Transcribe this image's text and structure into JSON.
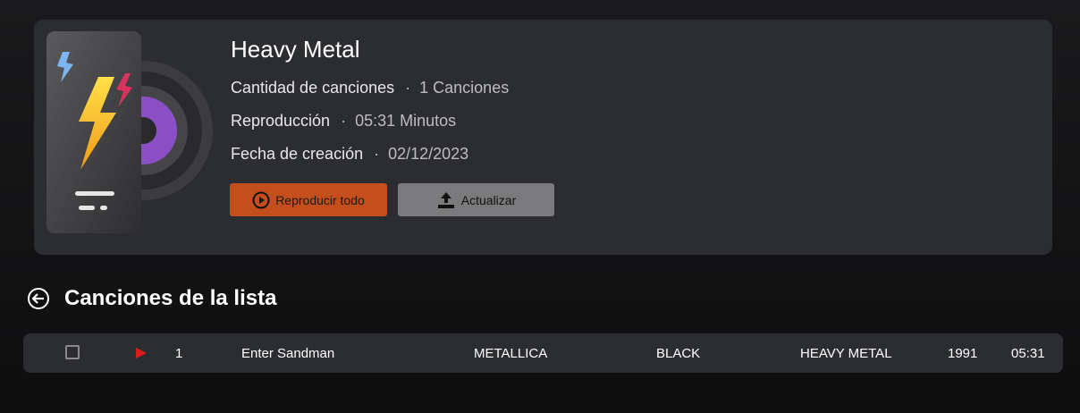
{
  "playlist": {
    "title": "Heavy Metal",
    "meta": [
      {
        "label": "Cantidad de canciones",
        "value": "1 Canciones"
      },
      {
        "label": "Reproducción",
        "value": "05:31 Minutos"
      },
      {
        "label": "Fecha de creación",
        "value": "02/12/2023"
      }
    ],
    "separator": "·",
    "buttons": {
      "play_all": "Reproducir todo",
      "update": "Actualizar"
    }
  },
  "section": {
    "title": "Canciones de la lista",
    "back_icon": "back-arrow-circle-icon"
  },
  "songs": [
    {
      "number": "1",
      "title": "Enter Sandman",
      "artist": "METALLICA",
      "album": "BLACK",
      "genre": "HEAVY METAL",
      "year": "1991",
      "duration": "05:31"
    }
  ],
  "colors": {
    "accent": "#c44f1d",
    "card": "#2b2d31",
    "secondary_button": "#7a7a7c",
    "play_marker": "#e01b1b"
  }
}
